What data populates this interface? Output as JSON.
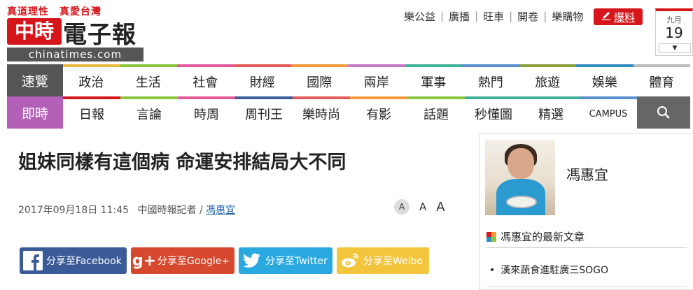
{
  "header": {
    "slogan": "真道理性　真愛台灣",
    "logo_mark": "中時",
    "logo_name": "電子報",
    "domain": "chinatimes.com",
    "top_links": [
      "樂公益",
      "廣播",
      "旺車",
      "開卷",
      "樂購物"
    ],
    "report_label": "爆料",
    "date": {
      "month": "九月",
      "day": "19"
    }
  },
  "nav_row1": {
    "first": "速覽",
    "items": [
      "政治",
      "生活",
      "社會",
      "財經",
      "國際",
      "兩岸",
      "軍事",
      "熱門",
      "旅遊",
      "娛樂",
      "體育"
    ],
    "colors": [
      "#e9b93a",
      "#8cc63f",
      "#e25a9a",
      "#e25a5a",
      "#f39a3c",
      "#c67ac8",
      "#3fb39a",
      "#5a8fd0",
      "#8a9e3a",
      "#2e8bc0",
      "#bbbbbb"
    ]
  },
  "nav_row2": {
    "first": "即時",
    "items": [
      "日報",
      "言論",
      "時周",
      "周刊王",
      "樂時尚",
      "有影",
      "話題",
      "秒懂圖",
      "精選",
      "CAMPUS"
    ],
    "colors": [
      "#d7161b",
      "#8cc63f",
      "#e25a9a",
      "#3a5a98",
      "#e25a5a",
      "#f39a3c",
      "#8cc63f",
      "#3fb39a",
      "#3fb39a",
      "#5a8fd0"
    ]
  },
  "article": {
    "headline": "姐妹同樣有這個病 命運安排結局大不同",
    "datetime": "2017年09月18日 11:45",
    "source": "中國時報記者 /",
    "author": "馮惠宜",
    "font_sizes": [
      "A",
      "A",
      "A"
    ]
  },
  "share": {
    "facebook": "分享至Facebook",
    "google": "分享至Google+",
    "twitter": "分享至Twitter",
    "weibo": "分享至Weibo"
  },
  "sidebar": {
    "author_name": "馮惠宜",
    "latest_title": "馮惠宜的最新文章",
    "articles": [
      "漢來蔬食進駐廣三SOGO"
    ]
  }
}
